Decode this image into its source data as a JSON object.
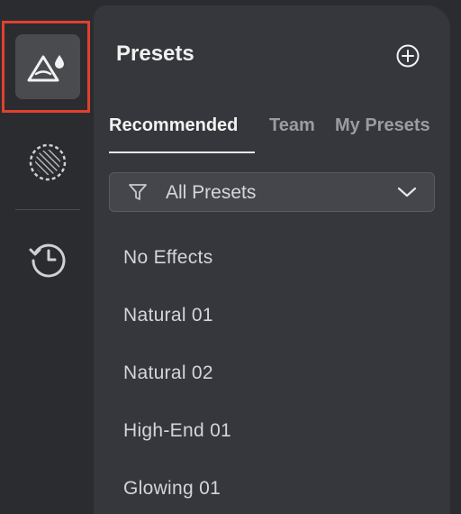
{
  "sidebar": {
    "items": [
      {
        "name": "presets",
        "icon": "mountain-drop-icon",
        "active": true
      },
      {
        "name": "effects",
        "icon": "dashed-circle-icon",
        "active": false
      },
      {
        "name": "history",
        "icon": "history-icon",
        "active": false
      }
    ]
  },
  "panel": {
    "title": "Presets",
    "add_icon": "plus-circle-icon"
  },
  "tabs": [
    {
      "label": "Recommended",
      "active": true
    },
    {
      "label": "Team",
      "active": false
    },
    {
      "label": "My Presets",
      "active": false
    }
  ],
  "filter": {
    "icon": "filter-icon",
    "selected": "All Presets",
    "chevron": "chevron-down-icon"
  },
  "presets": [
    {
      "label": "No Effects"
    },
    {
      "label": "Natural 01"
    },
    {
      "label": "Natural 02"
    },
    {
      "label": "High-End 01"
    },
    {
      "label": "Glowing 01"
    }
  ],
  "colors": {
    "background": "#2b2c30",
    "panel": "#36373c",
    "active_rail": "#4a4b4f",
    "focus_outline": "#e0412e",
    "text_primary": "#f0f0f0",
    "text_muted": "#9a9ca1"
  }
}
